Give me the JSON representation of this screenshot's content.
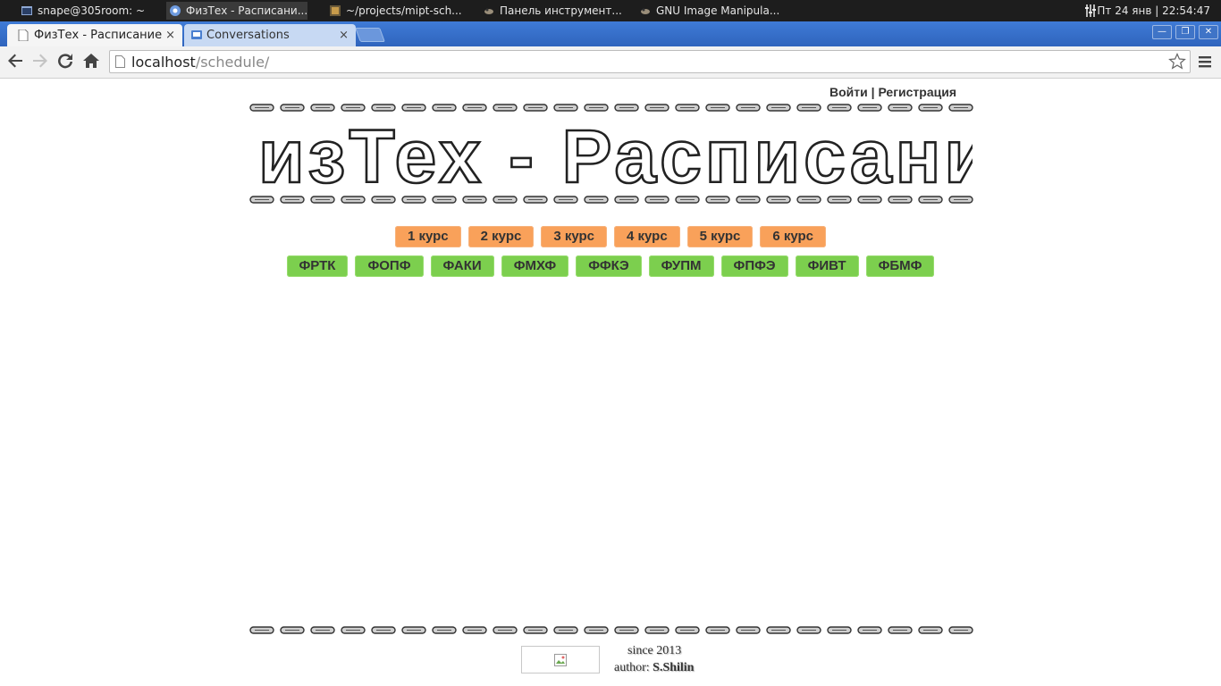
{
  "os_panel": {
    "tasks": [
      {
        "label": "snape@305room: ~",
        "icon": "terminal-icon"
      },
      {
        "label": "ФизТех - Расписани...",
        "icon": "chromium-icon"
      },
      {
        "label": "~/projects/mipt-sch...",
        "icon": "image-viewer-icon"
      },
      {
        "label": "Панель инструмент...",
        "icon": "gimp-icon"
      },
      {
        "label": "GNU Image Manipula...",
        "icon": "gimp-icon"
      }
    ],
    "clock": "Пт 24 янв | 22:54:47"
  },
  "browser": {
    "tabs": [
      {
        "label": "ФизТех - Расписание",
        "close": "×"
      },
      {
        "label": "Conversations",
        "close": "×"
      }
    ],
    "url": {
      "host": "localhost",
      "path": "/schedule/"
    }
  },
  "page": {
    "auth": {
      "login": "Войти",
      "separator": "|",
      "register": "Регистрация"
    },
    "title": "ФизТех - Расписание",
    "courses": [
      "1 курс",
      "2 курс",
      "3 курс",
      "4 курс",
      "5 курс",
      "6 курс"
    ],
    "faculties": [
      "ФРТК",
      "ФОПФ",
      "ФАКИ",
      "ФМХФ",
      "ФФКЭ",
      "ФУПМ",
      "ФПФЭ",
      "ФИВТ",
      "ФБМФ"
    ],
    "footer": {
      "since": "since 2013",
      "author_label": "author:",
      "author_name": "S.Shilin"
    },
    "colors": {
      "course_pill": "#f9a15a",
      "faculty_pill": "#7ccf4e"
    }
  }
}
